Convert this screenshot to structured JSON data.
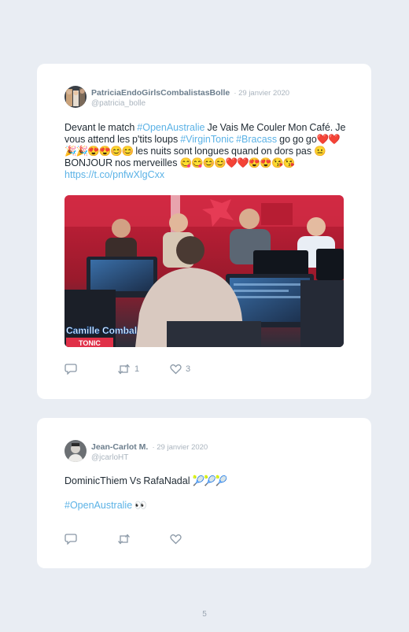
{
  "tweets": [
    {
      "author_name": "PatriciaEndoGirlsCombalistasBolle",
      "date": "· 29 janvier 2020",
      "handle": "@patricia_bolle",
      "text_parts": {
        "p1": "Devant le match ",
        "h1": "#OpenAustralie",
        "p2": " Je Vais Me Couler Mon Café. Je vous attend les p'tits loups ",
        "h2": "#VirginTonic",
        "p3": " ",
        "h3": "#Bracass",
        "p4": " go go go",
        "e1": "❤️❤️🎉🎉😍😍😊😊",
        "p5": " les nuits sont longues quand on dors pas ",
        "e2": "😐",
        "p6": " BONJOUR nos merveilles ",
        "e3": "😋😋😊😊❤️❤️😍😍😘",
        "e4": "😘",
        "p7": " ",
        "link": "https://t.co/pnfwXlgCxx"
      },
      "image_caption": "Camille Combal",
      "image_caption_2": "TONIC",
      "reply_count": "",
      "retweet_count": "1",
      "like_count": "3"
    },
    {
      "author_name": "Jean-Carlot M.",
      "date": "· 29 janvier 2020",
      "handle": "@jcarloHT",
      "line1": "DominicThiem Vs RafaNadal ",
      "line1_emoji": "🎾🎾🎾",
      "line2_hashtag": "#OpenAustralie",
      "line2_emoji": " 👀",
      "reply_count": "",
      "retweet_count": "",
      "like_count": ""
    }
  ],
  "page_number": "5",
  "colors": {
    "background": "#e9edf3",
    "card": "#ffffff",
    "hashtag": "#5bb2e6",
    "muted": "#aab4be",
    "icon": "#8a98a6"
  },
  "icons": {
    "reply": "reply-icon",
    "retweet": "retweet-icon",
    "like": "heart-icon"
  }
}
